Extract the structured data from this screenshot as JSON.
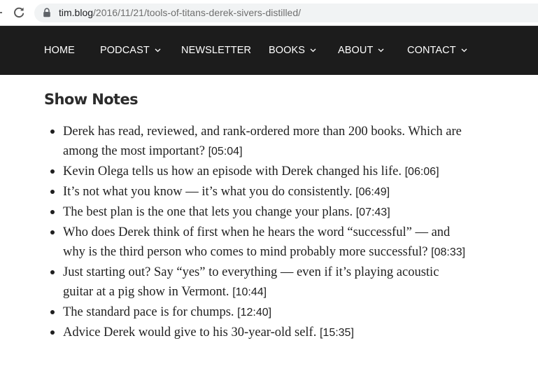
{
  "browser": {
    "url_host": "tim.blog",
    "url_path": "/2016/11/21/tools-of-titans-derek-sivers-distilled/",
    "reload_icon": "reload-icon",
    "lock_icon": "lock-icon"
  },
  "nav": {
    "items": [
      {
        "label": "HOME",
        "has_dropdown": false
      },
      {
        "label": "PODCAST",
        "has_dropdown": true
      },
      {
        "label": "NEWSLETTER",
        "has_dropdown": false
      },
      {
        "label": "BOOKS",
        "has_dropdown": true
      },
      {
        "label": "ABOUT",
        "has_dropdown": true
      },
      {
        "label": "CONTACT",
        "has_dropdown": true
      }
    ],
    "background": "#1c1c1c",
    "text_color": "#ffffff"
  },
  "content": {
    "heading": "Show Notes",
    "notes": [
      {
        "text": "Derek has read, reviewed, and rank-ordered more than 200 books. Which are among the most important?",
        "timestamp": "[05:04]"
      },
      {
        "text": "Kevin Olega tells us how an episode with Derek changed his life.",
        "timestamp": "[06:06]"
      },
      {
        "text": "It’s not what you know — it’s what you do consistently.",
        "timestamp": "[06:49]"
      },
      {
        "text": "The best plan is the one that lets you change your plans.",
        "timestamp": "[07:43]"
      },
      {
        "text": "Who does Derek think of first when he hears the word “successful” — and why is the third person who comes to mind probably more successful?",
        "timestamp": "[08:33]"
      },
      {
        "text": "Just starting out? Say “yes” to everything — even if it’s playing acoustic guitar at a pig show in Vermont.",
        "timestamp": "[10:44]"
      },
      {
        "text": "The standard pace is for chumps.",
        "timestamp": "[12:40]"
      },
      {
        "text": "Advice Derek would give to his 30-year-old self.",
        "timestamp": "[15:35]"
      }
    ]
  }
}
